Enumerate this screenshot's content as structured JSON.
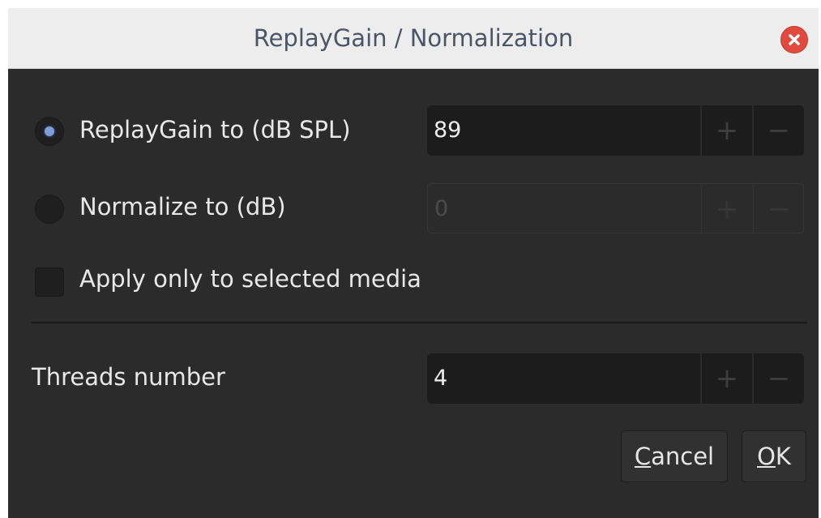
{
  "dialog": {
    "title": "ReplayGain / Normalization"
  },
  "replaygain": {
    "label": "ReplayGain to (dB SPL)",
    "selected": true,
    "value": "89"
  },
  "normalize": {
    "label": "Normalize to (dB)",
    "selected": false,
    "value": "0"
  },
  "apply_selected": {
    "label": "Apply only to selected media",
    "checked": false
  },
  "threads": {
    "label": "Threads number",
    "value": "4"
  },
  "spin": {
    "plus_symbol": "+",
    "minus_symbol": "−"
  },
  "buttons": {
    "cancel_mnemonic": "C",
    "cancel_rest": "ancel",
    "ok_mnemonic": "O",
    "ok_rest": "K"
  },
  "icons": {
    "close": "close-icon",
    "close_color": "#e04a3f",
    "radio_dot_color": "#7f9ed6"
  }
}
